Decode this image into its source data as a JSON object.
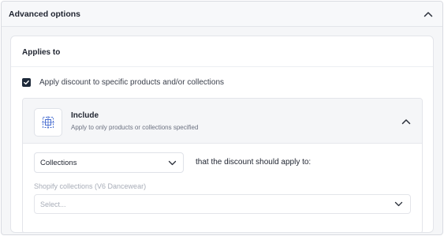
{
  "advanced": {
    "title": "Advanced options",
    "toggle_icon": "chevron-up-icon"
  },
  "applies_to": {
    "title": "Applies to",
    "checkbox_label": "Apply discount to specific products and/or collections",
    "checkbox_checked": true
  },
  "include": {
    "title": "Include",
    "subtitle": "Apply to only products or collections specified",
    "icon": "collection-select-icon",
    "toggle_icon": "chevron-up-icon"
  },
  "type_select": {
    "value": "Collections",
    "suffix_text": "that the discount should apply to:"
  },
  "collections_select": {
    "label": "Shopify collections (V6 Dancewear)",
    "placeholder": "Select..."
  },
  "colors": {
    "checkbox": "#1e2a3a",
    "border": "#dfe2e8",
    "muted_text": "#a8adb8"
  }
}
